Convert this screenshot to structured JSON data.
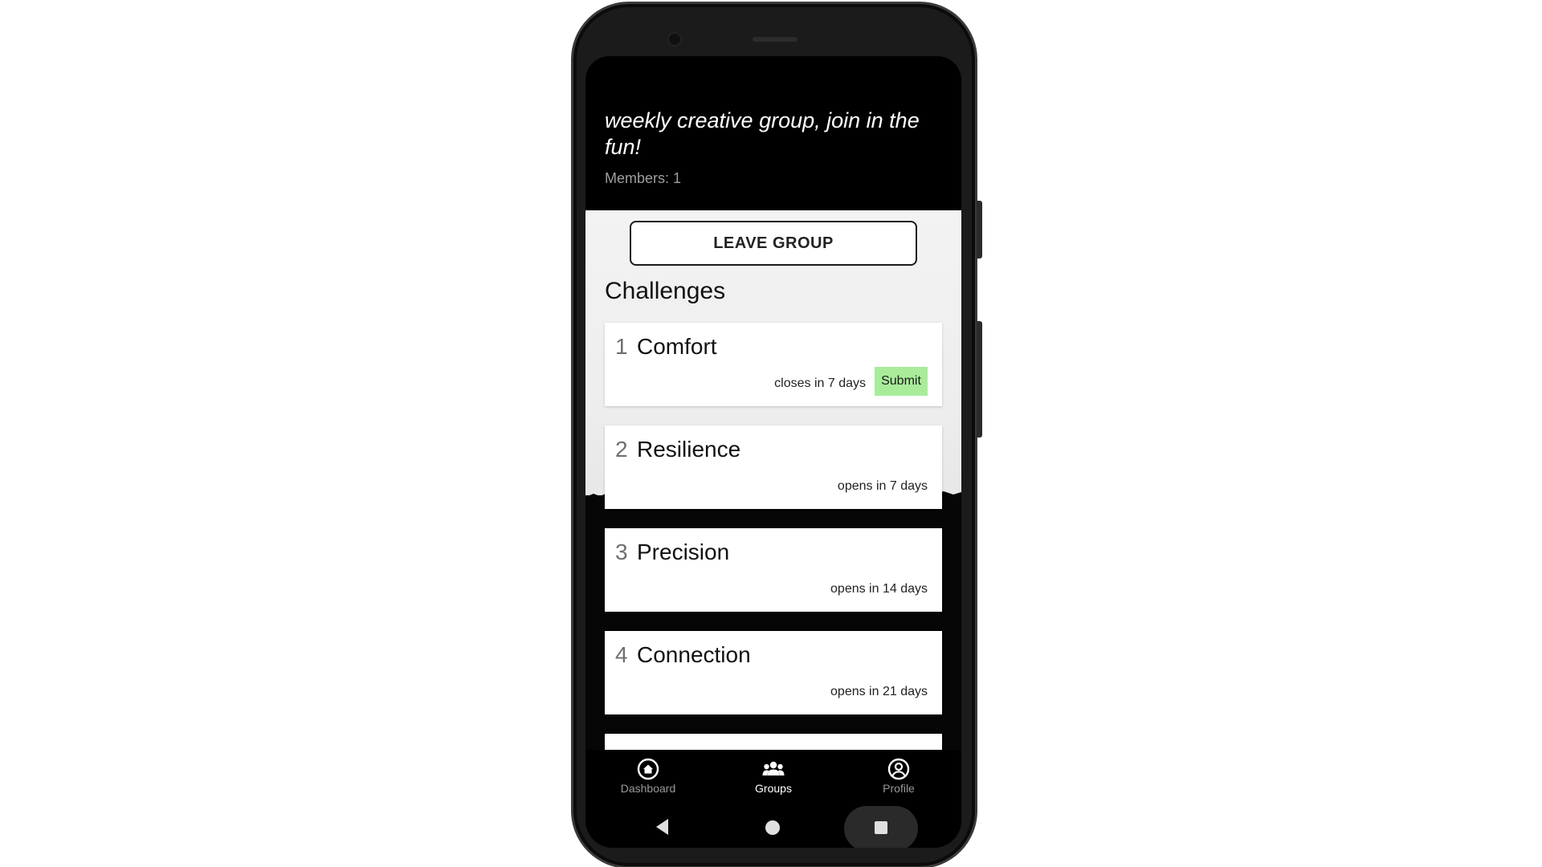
{
  "group": {
    "description": "weekly creative group, join in the fun!",
    "members": "Members: 1",
    "leave_label": "LEAVE GROUP"
  },
  "challenges": {
    "section_title": "Challenges",
    "items": [
      {
        "number": "1",
        "title": "Comfort",
        "status": "closes in 7 days",
        "action": "Submit"
      },
      {
        "number": "2",
        "title": "Resilience",
        "status": "opens in 7 days"
      },
      {
        "number": "3",
        "title": "Precision",
        "status": "opens in 14 days"
      },
      {
        "number": "4",
        "title": "Connection",
        "status": "opens in 21 days"
      }
    ]
  },
  "nav": {
    "items": [
      {
        "label": "Dashboard",
        "icon": "home-icon",
        "active": false
      },
      {
        "label": "Groups",
        "icon": "groups-icon",
        "active": true
      },
      {
        "label": "Profile",
        "icon": "profile-icon",
        "active": false
      }
    ]
  },
  "system_nav": {
    "buttons": [
      "back-icon",
      "home-circle-icon",
      "recents-icon"
    ]
  },
  "colors": {
    "submit_bg": "#a8ec9a",
    "header_bg": "#000000",
    "nav_active": "#ffffff",
    "nav_inactive": "#9a9a9a"
  }
}
